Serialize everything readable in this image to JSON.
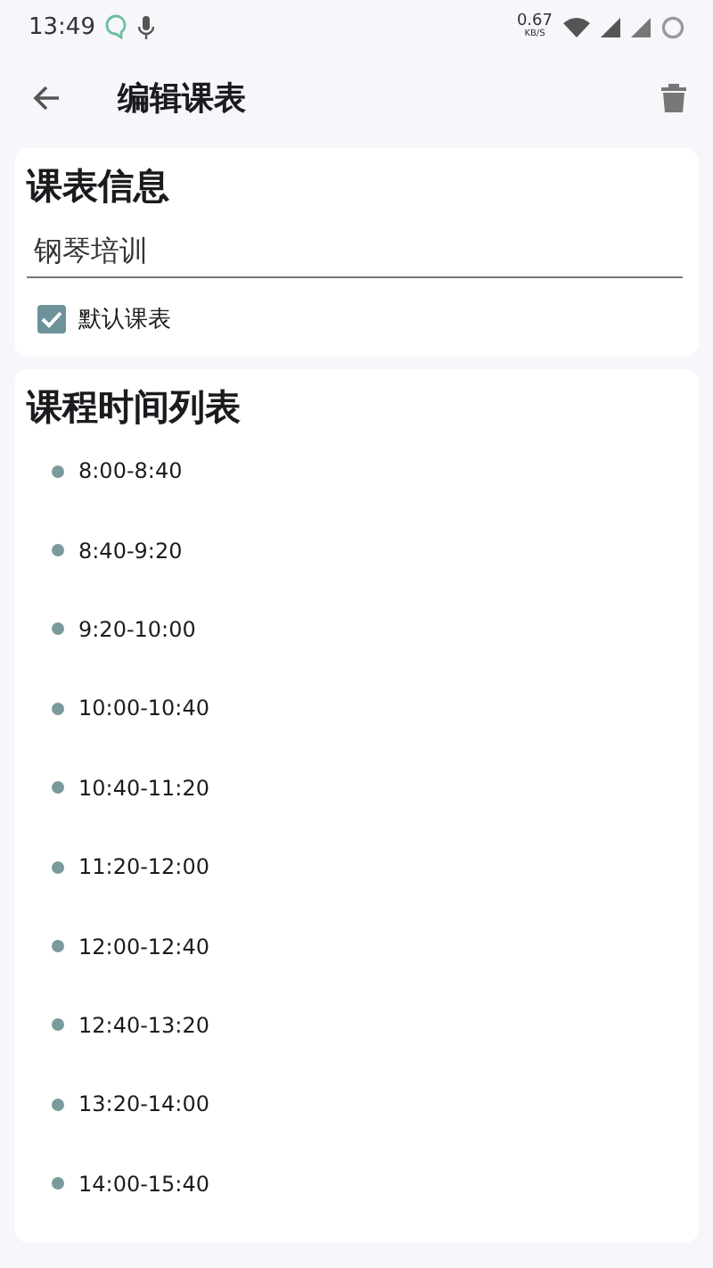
{
  "status_bar": {
    "time": "13:49",
    "net_speed": "0.67",
    "net_unit": "KB/S"
  },
  "app_bar": {
    "title": "编辑课表"
  },
  "info_card": {
    "title": "课表信息",
    "name_field": {
      "value": "钢琴培训"
    },
    "default_checkbox": {
      "label": "默认课表",
      "checked": true
    }
  },
  "times_card": {
    "title": "课程时间列表",
    "items": [
      {
        "label": "8:00-8:40"
      },
      {
        "label": "8:40-9:20"
      },
      {
        "label": "9:20-10:00"
      },
      {
        "label": "10:00-10:40"
      },
      {
        "label": "10:40-11:20"
      },
      {
        "label": "11:20-12:00"
      },
      {
        "label": "12:00-12:40"
      },
      {
        "label": "12:40-13:20"
      },
      {
        "label": "13:20-14:00"
      },
      {
        "label": "14:00-15:40"
      }
    ]
  }
}
